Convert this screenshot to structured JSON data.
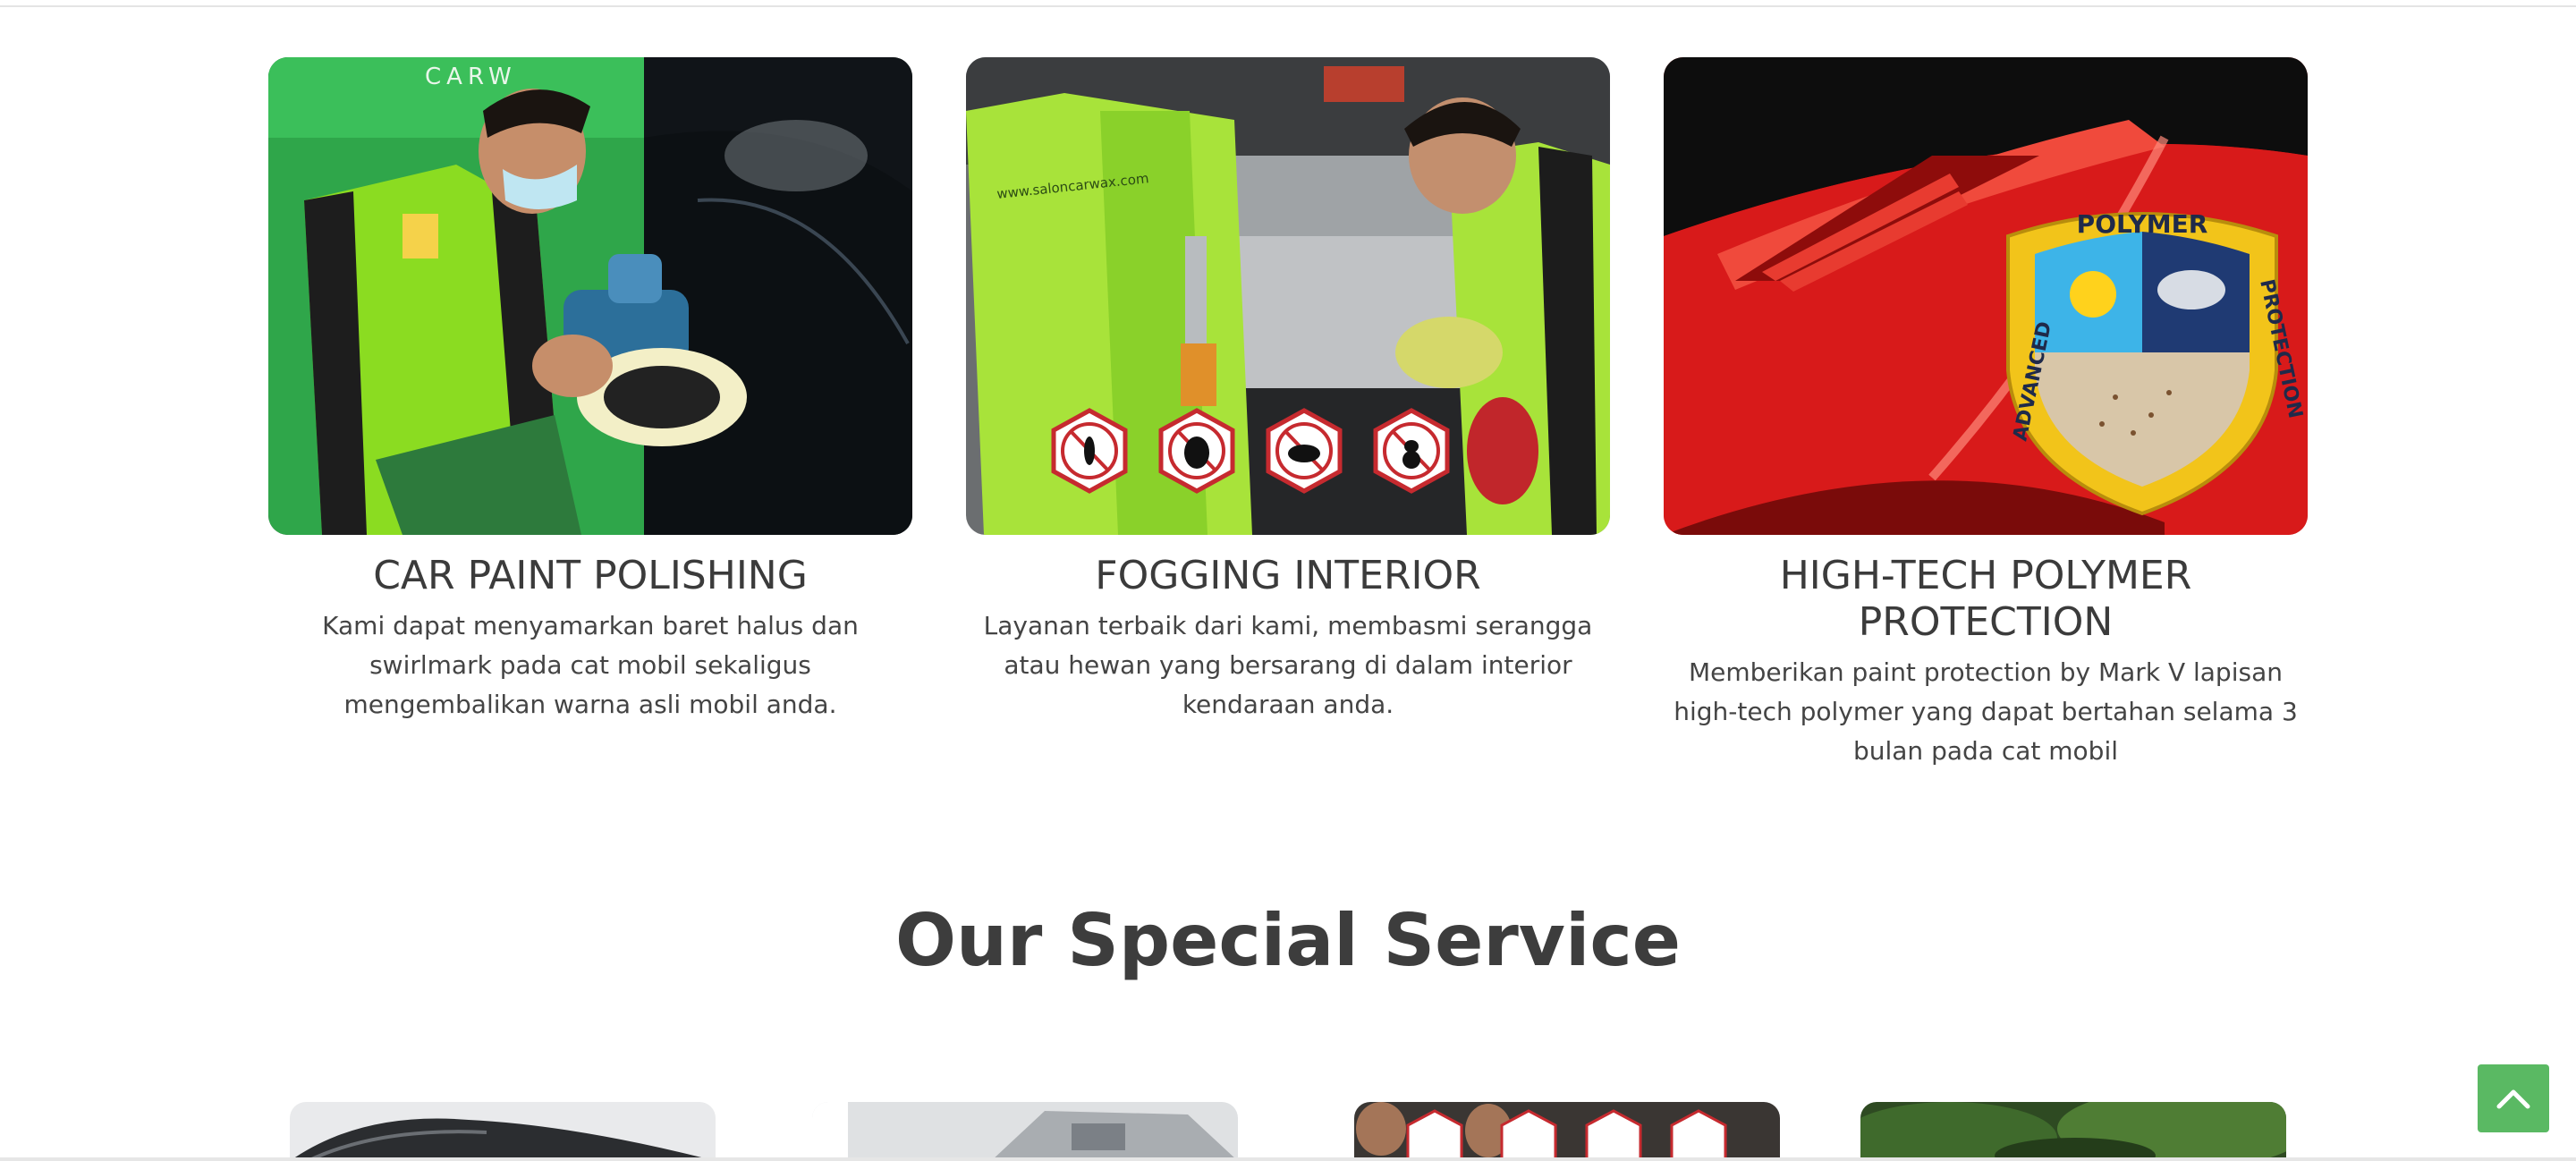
{
  "services": [
    {
      "title": "CAR PAINT POLISHING",
      "description": "Kami dapat menyamarkan baret halus dan swirlmark pada cat mobil sekaligus mengembalikan warna asli mobil anda."
    },
    {
      "title": "FOGGING INTERIOR",
      "description": "Layanan terbaik dari kami, membasmi serangga atau hewan yang bersarang di dalam interior kendaraan anda."
    },
    {
      "title": "HIGH-TECH POLYMER PROTECTION",
      "description": "Memberikan paint protection by Mark V lapisan high-tech polymer yang dapat bertahan selama 3 bulan pada cat mobil"
    }
  ],
  "photo_text": {
    "banner": "CARW",
    "shirt_url": "www.saloncarwax.com",
    "badge_top": "POLYMER",
    "badge_left": "ADVANCED",
    "badge_right": "PROTECTION"
  },
  "special_section": {
    "heading": "Our Special Service"
  },
  "back_to_top": {
    "icon": "chevron-up-icon"
  },
  "colors": {
    "accent_green": "#5ab963",
    "shirt_green": "#9be22a",
    "badge_gold": "#f2c41a",
    "car_red": "#d81a1a",
    "heading": "#3d3d3d"
  }
}
